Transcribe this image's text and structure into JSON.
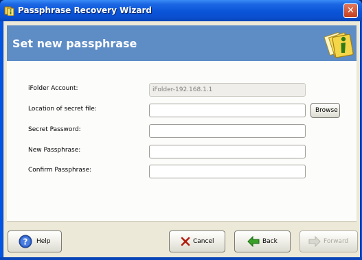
{
  "window": {
    "title": "Passphrase Recovery Wizard",
    "close_label": "✕"
  },
  "header": {
    "title": "Set new passphrase"
  },
  "form": {
    "account_label": "iFolder Account:",
    "account_value": "iFolder-192.168.1.1",
    "secret_file_label": "Location of secret file:",
    "secret_file_value": "",
    "secret_password_label": "Secret Password:",
    "secret_password_value": "",
    "new_passphrase_label": "New Passphrase:",
    "new_passphrase_value": "",
    "confirm_passphrase_label": "Confirm Passphrase:",
    "confirm_passphrase_value": "",
    "browse_label": "Browse"
  },
  "buttons": {
    "help_label": "Help",
    "cancel_label": "Cancel",
    "back_label": "Back",
    "forward_label": "Forward"
  },
  "colors": {
    "header_bg": "#5e8dc6",
    "titlebar": "#0a54d8"
  }
}
